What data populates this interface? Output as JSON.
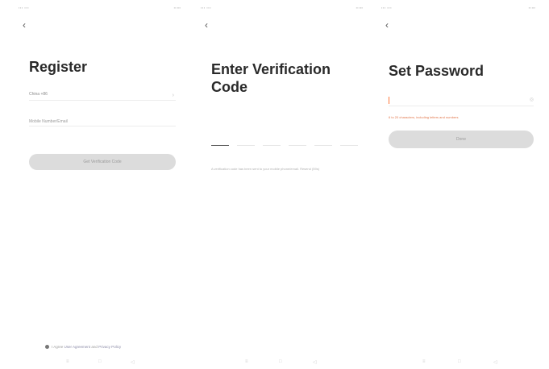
{
  "register": {
    "title": "Register",
    "region": "China +86",
    "phone_placeholder": "Mobile Number/Email",
    "get_code_button": "Get Verification Code",
    "agreement_prefix": "I Agree",
    "agreement_and": "and",
    "agreement_user": "User Agreement",
    "agreement_privacy": "Privacy Policy"
  },
  "verify": {
    "title": "Enter Verification Code",
    "hint": "A verification code has been sent to your mobile phone/email. Resend (59s)"
  },
  "password": {
    "title": "Set Password",
    "aux": "",
    "error": "6 to 20 characters, including letters and numbers",
    "done_button": "Done"
  },
  "icons": {
    "back": "back-arrow-icon",
    "eye": "eye-icon",
    "chevron": "chevron-right-icon",
    "nav_menu": "menu-icon",
    "nav_home": "home-icon",
    "nav_back": "nav-back-icon"
  },
  "colors": {
    "accent": "#ff7a3d",
    "error": "#e2784d",
    "button_disabled": "#dcdcdc"
  }
}
